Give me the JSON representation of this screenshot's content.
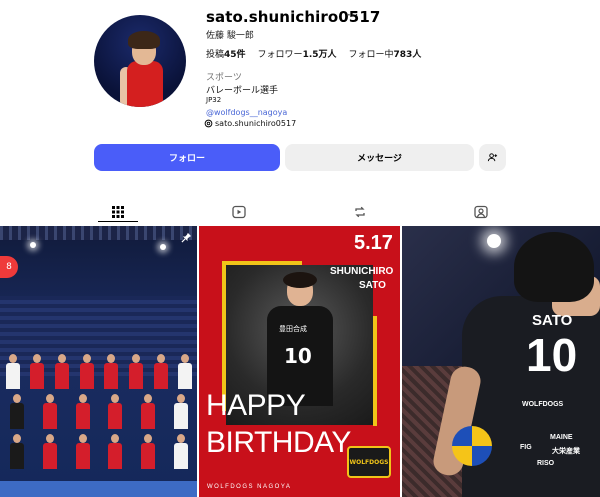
{
  "profile": {
    "username": "sato.shunichiro0517",
    "more_label": "···",
    "full_name": "佐藤 駿一郎",
    "posts_label": "投稿",
    "posts_count": "45件",
    "followers_label": "フォロワー",
    "followers_count": "1.5万人",
    "following_label": "フォロー中",
    "following_count": "783人",
    "category": "スポーツ",
    "bio_line1": "バレーボール選手",
    "bio_line2": "JP32",
    "link": "@wolfdogs__nagoya",
    "threads_handle": "sato.shunichiro0517"
  },
  "actions": {
    "follow_label": "フォロー",
    "message_label": "メッセージ",
    "add_user_icon": "person-plus-icon"
  },
  "tabs": [
    {
      "name": "posts",
      "icon": "grid-icon",
      "active": true
    },
    {
      "name": "reels",
      "icon": "reels-icon",
      "active": false
    },
    {
      "name": "reposts",
      "icon": "repost-icon",
      "active": false
    },
    {
      "name": "tagged",
      "icon": "tagged-icon",
      "active": false
    }
  ],
  "posts": [
    {
      "name": "team-photo",
      "pinned": true,
      "badge": "8"
    },
    {
      "name": "birthday-card",
      "date": "5.17",
      "name_line1": "SHUNICHIRO",
      "name_line2": "SATO",
      "happy": "HAPPY",
      "birthday": "BIRTHDAY",
      "jersey_number": "10",
      "jersey_text": "豊田合成",
      "logo": "WOLFDOGS",
      "footer": "WOLFDOGS NAGOYA"
    },
    {
      "name": "jersey-back",
      "jersey_name": "SATO",
      "jersey_number": "10",
      "sponsor1": "WOLFDOGS",
      "sponsor2": "MAINE",
      "sponsor3": "RISO",
      "sponsor4": "FIG",
      "sponsor5": "大栄産業"
    }
  ],
  "colors": {
    "follow_button": "#4a5df9",
    "secondary_button": "#efefef",
    "link": "#4a67d6",
    "badge": "#ef3a3a"
  }
}
